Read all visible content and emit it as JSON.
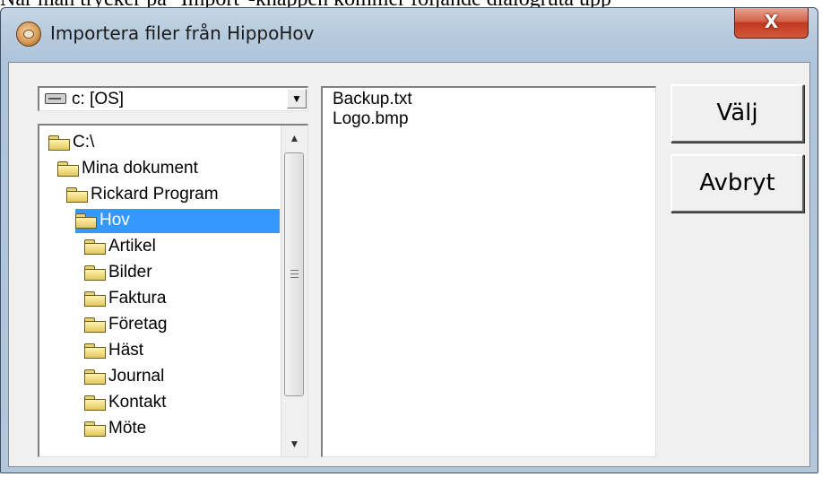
{
  "caption": "När man trycker på \"Import\"-knappen kommer följande dialogruta upp",
  "window": {
    "title": "Importera filer från HippoHov",
    "close_label": "X",
    "icons": {
      "app": "hippohov-app-icon",
      "close": "close-icon"
    }
  },
  "drive": {
    "value": "c: [OS]",
    "icon": "drive-icon",
    "arrow": "▼"
  },
  "folders": [
    {
      "label": "C:\\",
      "indent": 0,
      "icon": "open-folder-icon"
    },
    {
      "label": "Mina dokument",
      "indent": 1,
      "icon": "open-folder-icon"
    },
    {
      "label": "Rickard Program",
      "indent": 2,
      "icon": "open-folder-icon"
    },
    {
      "label": "Hov",
      "indent": 3,
      "icon": "open-folder-icon",
      "selected": true
    },
    {
      "label": "Artikel",
      "indent": 4,
      "icon": "folder-icon"
    },
    {
      "label": "Bilder",
      "indent": 4,
      "icon": "folder-icon"
    },
    {
      "label": "Faktura",
      "indent": 4,
      "icon": "folder-icon"
    },
    {
      "label": "Företag",
      "indent": 4,
      "icon": "folder-icon"
    },
    {
      "label": "Häst",
      "indent": 4,
      "icon": "folder-icon"
    },
    {
      "label": "Journal",
      "indent": 4,
      "icon": "folder-icon"
    },
    {
      "label": "Kontakt",
      "indent": 4,
      "icon": "folder-icon"
    },
    {
      "label": "Möte",
      "indent": 4,
      "icon": "folder-icon"
    }
  ],
  "scrollbar": {
    "up": "▲",
    "down": "▼"
  },
  "files": [
    "Backup.txt",
    "Logo.bmp"
  ],
  "buttons": {
    "select": "Välj",
    "cancel": "Avbryt"
  },
  "colors": {
    "selection": "#3399ff",
    "close_button": "#c1371f",
    "window_frame": "#b7cbde",
    "client": "#f0f0f0"
  }
}
